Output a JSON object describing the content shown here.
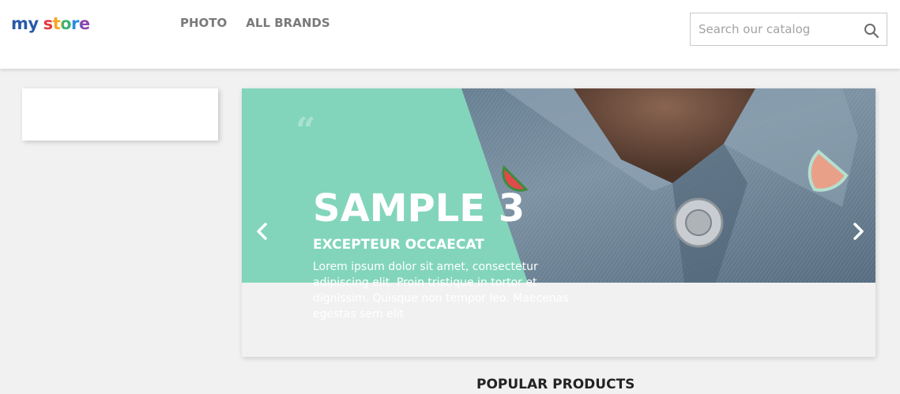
{
  "header": {
    "logo": {
      "part1": "my",
      "part2": "store"
    },
    "nav": [
      {
        "label": "PHOTO"
      },
      {
        "label": "ALL BRANDS"
      }
    ],
    "search": {
      "placeholder": "Search our catalog",
      "value": ""
    }
  },
  "slider": {
    "quote": "“",
    "title": "SAMPLE 3",
    "subtitle": "EXCEPTEUR OCCAECAT",
    "text": "Lorem ipsum dolor sit amet, consectetur adipiscing elit. Proin tristique in tortor et dignissim. Quisque non tempor leo. Maecenas egestas sem elit",
    "icons": {
      "prev": "chevron-left-icon",
      "next": "chevron-right-icon"
    }
  },
  "sections": {
    "popular_title": "POPULAR PRODUCTS"
  },
  "colors": {
    "accent_mint": "#82d5bb",
    "denim": "#6d8699",
    "nav_text": "#7a7a7a",
    "title_text": "#232323"
  }
}
